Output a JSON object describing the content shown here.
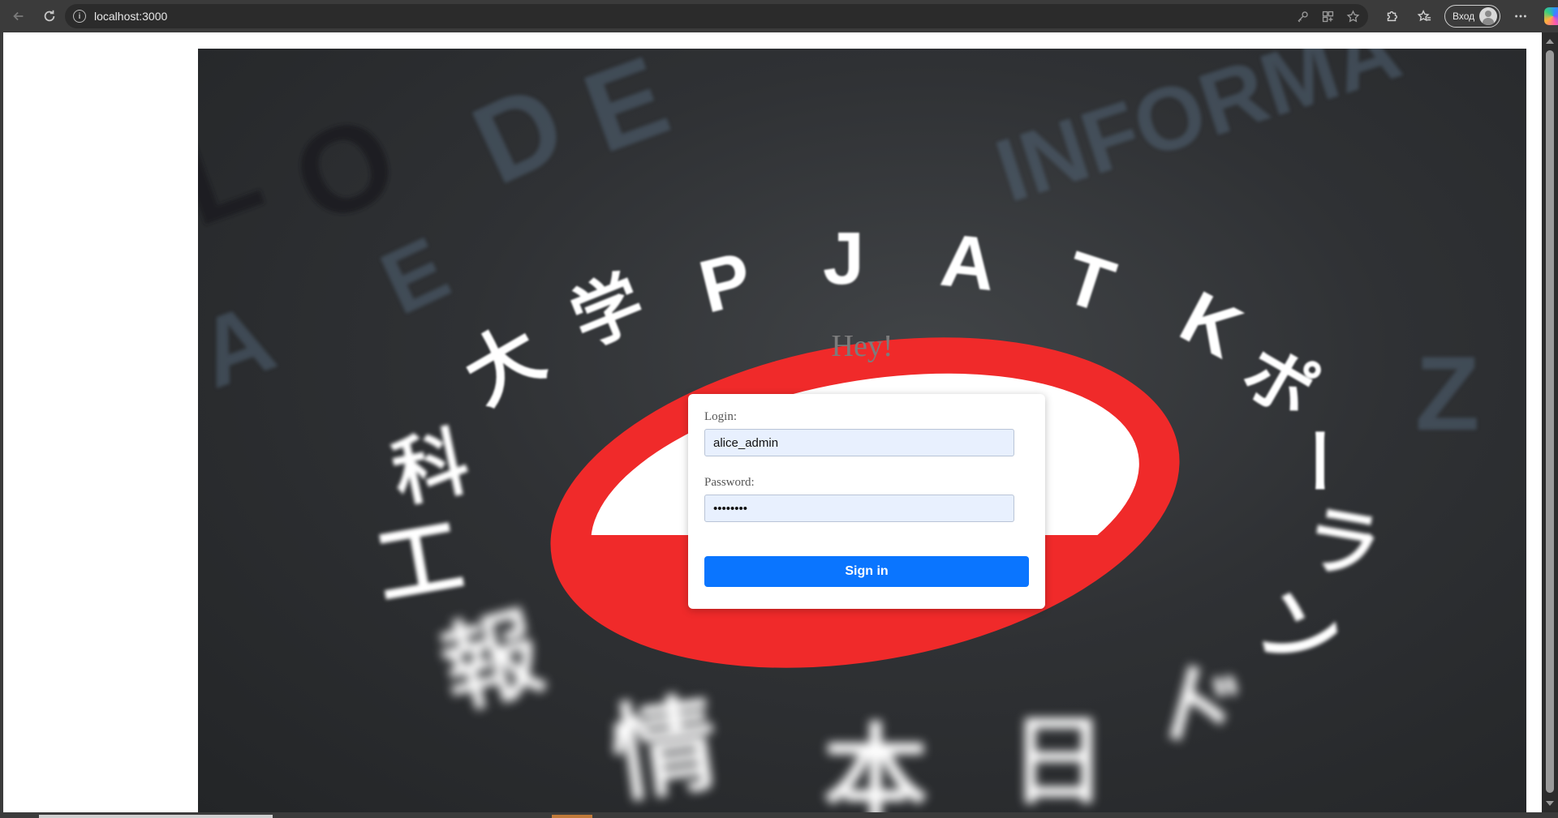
{
  "browser": {
    "url": "localhost:3000",
    "profile_label": "Вход",
    "nav": {
      "back_icon": "back-arrow-icon",
      "reload_icon": "reload-icon"
    },
    "address_icons": [
      "key-icon",
      "app-grid-icon",
      "star-icon"
    ],
    "toolbar_icons": [
      "extensions-icon",
      "favorites-icon",
      "more-icon",
      "copilot-icon"
    ]
  },
  "hero": {
    "ring_letters": [
      "P",
      "J",
      "A",
      "T",
      "K"
    ],
    "ring_kana": [
      "大",
      "学",
      "ポ",
      "ー",
      "ラ",
      "ン",
      "ド",
      "日",
      "本",
      "情",
      "報",
      "工",
      "科"
    ],
    "background_letters": "INFORMA",
    "colors": {
      "red": "#f02a2a",
      "white": "#ffffff",
      "dark": "#2f3134"
    }
  },
  "login": {
    "greeting": "Hey!",
    "login_label": "Login:",
    "login_value": "alice_admin",
    "password_label": "Password:",
    "password_value": "••••••••",
    "submit_label": "Sign in",
    "accent_color": "#0a75ff"
  }
}
